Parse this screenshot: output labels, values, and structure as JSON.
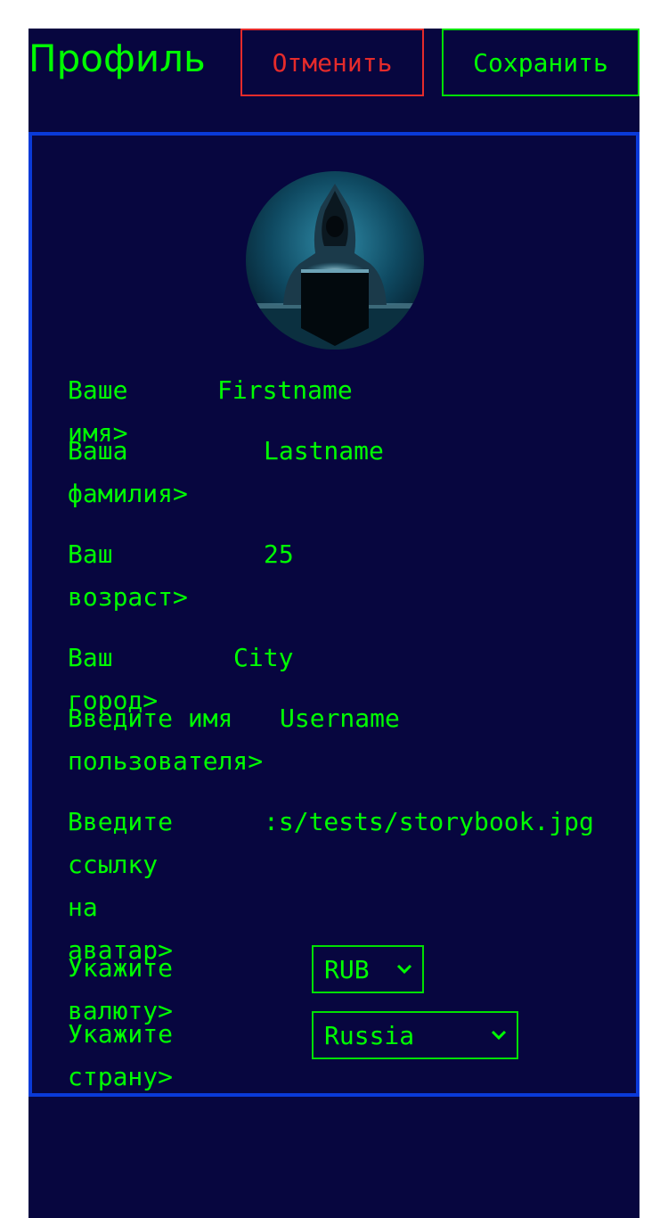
{
  "header": {
    "title": "Профиль",
    "cancel_label": "Отменить",
    "save_label": "Сохранить"
  },
  "colors": {
    "background": "#07063f",
    "accent": "#00ff00",
    "danger": "#e52b2b",
    "card_border": "#0a3ad8"
  },
  "profile": {
    "avatar_icon": "hooded-hacker-avatar",
    "fields": [
      {
        "label": "Ваше имя>",
        "value": "Firstname"
      },
      {
        "label": "Ваша\nфамилия>",
        "value": "Lastname"
      },
      {
        "label": "Ваш\nвозраст>",
        "value": "25"
      },
      {
        "label": "Ваш город>",
        "value": "City"
      },
      {
        "label": "Введите имя\nпользователя>",
        "value": "Username"
      },
      {
        "label": "Введите\nссылку на\nаватар>",
        "value": ":s/tests/storybook.jpg"
      }
    ],
    "currency": {
      "label": "Укажите валюту>",
      "selected": "RUB"
    },
    "country": {
      "label": "Укажите страну>",
      "selected": "Russia"
    }
  }
}
